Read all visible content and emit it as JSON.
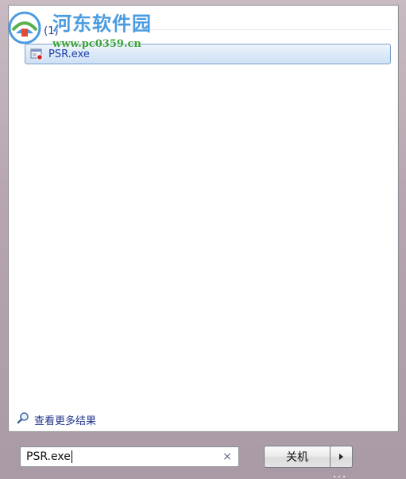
{
  "results": {
    "group_header": "程序 (1)",
    "items": [
      {
        "label": "PSR.exe",
        "icon": "psr-app-icon"
      }
    ],
    "see_more": "查看更多结果"
  },
  "search": {
    "value": "PSR.exe",
    "clear_icon": "×"
  },
  "shutdown": {
    "label": "关机",
    "arrow_icon": "chevron-right-icon"
  },
  "watermark": {
    "title": "河东软件园",
    "url": "www.pc0359.cn"
  },
  "colors": {
    "link_blue": "#1e3287",
    "selection_border": "#7da2ce",
    "watermark_blue": "#4a9be0",
    "watermark_green": "#3aa23a"
  }
}
